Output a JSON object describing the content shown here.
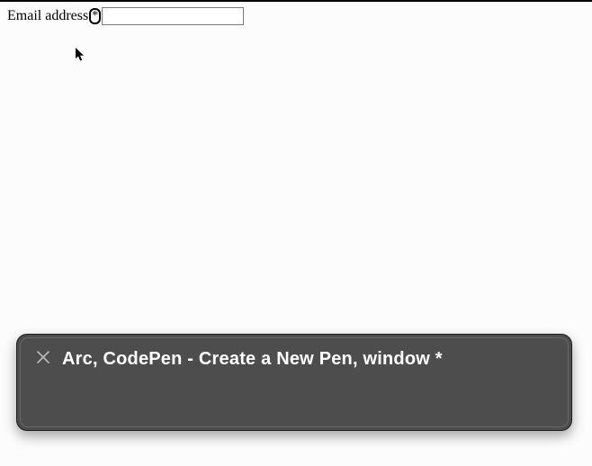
{
  "form": {
    "email_label": "Email address",
    "required_marker": "*",
    "email_value": ""
  },
  "toast": {
    "title": "Arc, CodePen - Create a New Pen, window *"
  }
}
